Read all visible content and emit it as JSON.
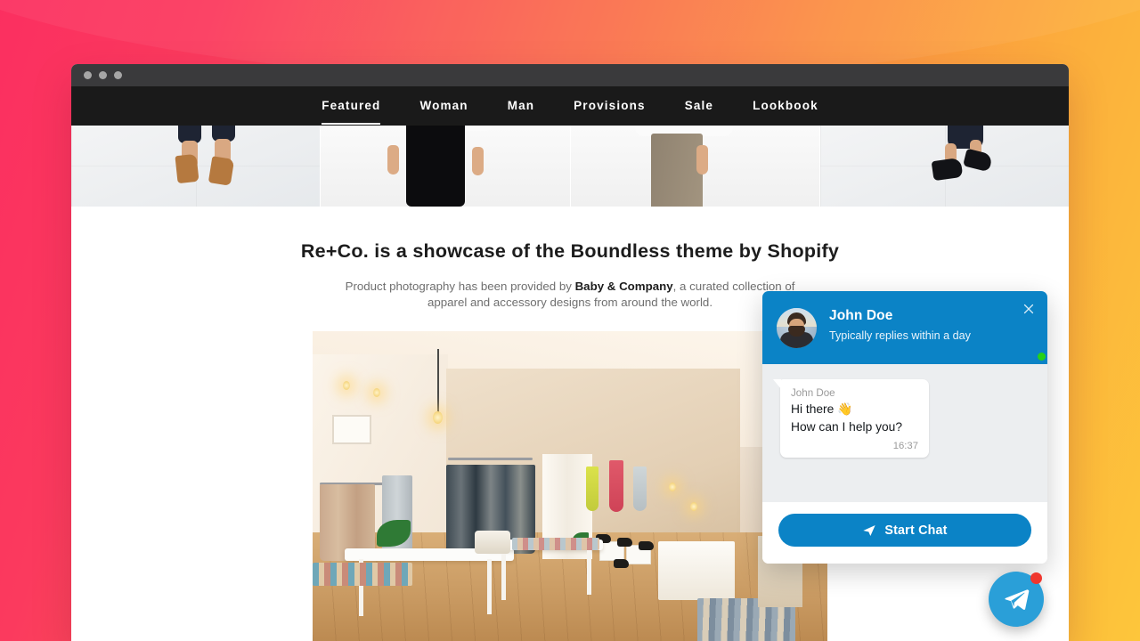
{
  "background": {
    "gradient_from": "#fb2f60",
    "gradient_mid": "#fa6a4f",
    "gradient_to": "#fdc63b"
  },
  "browser": {
    "traffic_lights": [
      "close-dot",
      "minimize-dot",
      "maximize-dot"
    ]
  },
  "site": {
    "nav": [
      {
        "label": "Featured",
        "active": true
      },
      {
        "label": "Woman",
        "active": false
      },
      {
        "label": "Man",
        "active": false
      },
      {
        "label": "Provisions",
        "active": false
      },
      {
        "label": "Sale",
        "active": false
      },
      {
        "label": "Lookbook",
        "active": false
      }
    ],
    "photo_tiles": [
      {
        "alt": "woman-in-tan-sandals"
      },
      {
        "alt": "model-in-black-trousers"
      },
      {
        "alt": "model-in-taupe-skirt"
      },
      {
        "alt": "man-in-black-shoes"
      }
    ],
    "headline": "Re+Co. is a showcase of the Boundless theme by Shopify",
    "subcopy_before": "Product photography has been provided by ",
    "subcopy_link": "Baby & Company",
    "subcopy_after": ", a curated collection of apparel and accessory designs from around the world.",
    "hero_alt": "boutique-store-interior"
  },
  "chat": {
    "agent_name": "John Doe",
    "agent_status": "Typically replies within a day",
    "online": true,
    "close_icon": "close-icon",
    "message": {
      "sender": "John Doe",
      "line1": "Hi there 👋",
      "line2": "How can I help you?",
      "time": "16:37"
    },
    "start_button_label": "Start Chat",
    "start_button_icon": "paper-plane-icon",
    "header_color": "#0b83c6",
    "body_color": "#eceef0"
  },
  "launcher": {
    "icon": "telegram-paper-plane-icon",
    "color": "#2a9fd8",
    "badge_color": "#f0372e",
    "has_badge": true
  }
}
